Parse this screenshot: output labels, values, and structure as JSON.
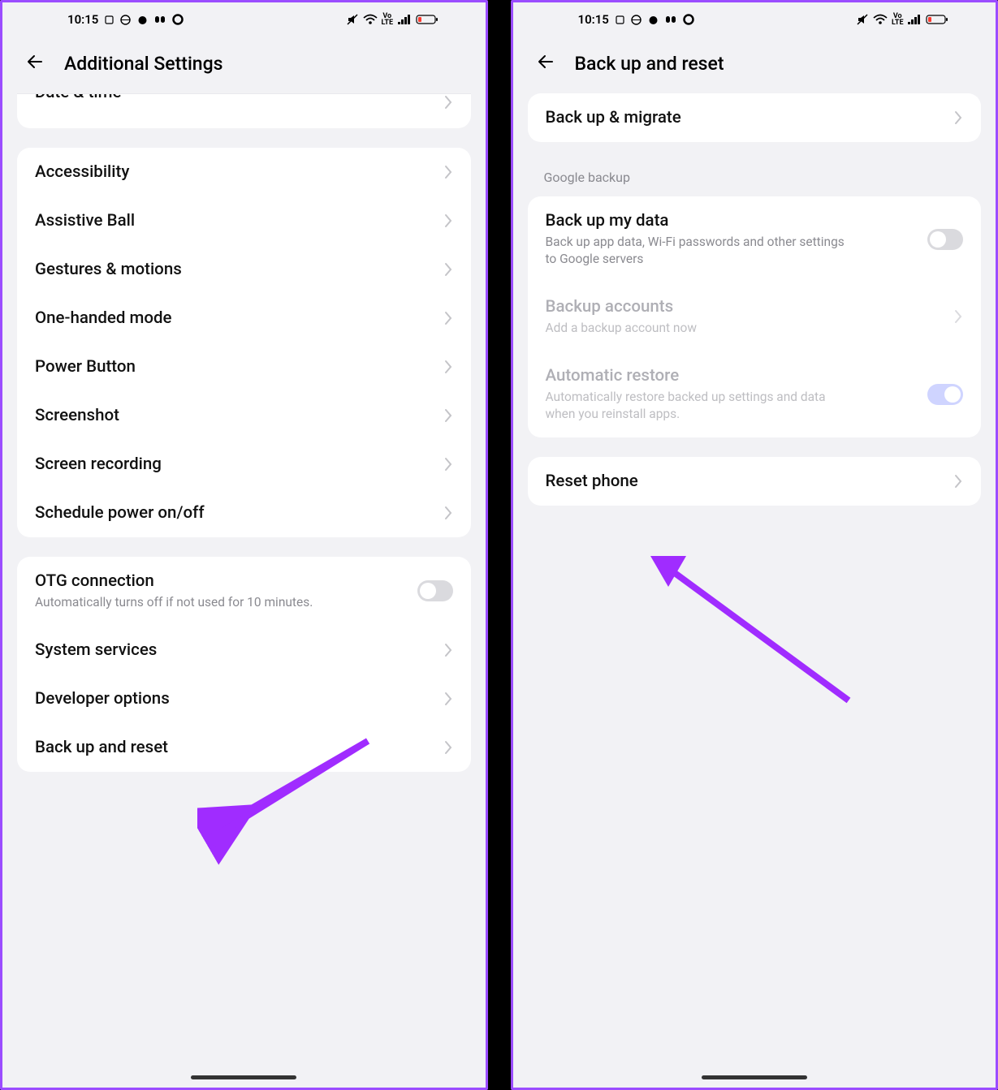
{
  "status": {
    "time": "10:15",
    "volte": "Vo LTE"
  },
  "left": {
    "header": "Additional Settings",
    "peek_item": "Date & time",
    "group1": [
      "Accessibility",
      "Assistive Ball",
      "Gestures & motions",
      "One-handed mode",
      "Power Button",
      "Screenshot",
      "Screen recording",
      "Schedule power on/off"
    ],
    "otg": {
      "title": "OTG connection",
      "sub": "Automatically turns off if not used for 10 minutes."
    },
    "group2": [
      "System services",
      "Developer options",
      "Back up and reset"
    ]
  },
  "right": {
    "header": "Back up and reset",
    "backup_migrate": "Back up & migrate",
    "section_label": "Google backup",
    "backup_data": {
      "title": "Back up my data",
      "sub": "Back up app data, Wi-Fi passwords and other settings to Google servers"
    },
    "backup_accounts": {
      "title": "Backup accounts",
      "sub": "Add a backup account now"
    },
    "auto_restore": {
      "title": "Automatic restore",
      "sub": "Automatically restore backed up settings and data when you reinstall apps."
    },
    "reset_phone": "Reset phone"
  }
}
